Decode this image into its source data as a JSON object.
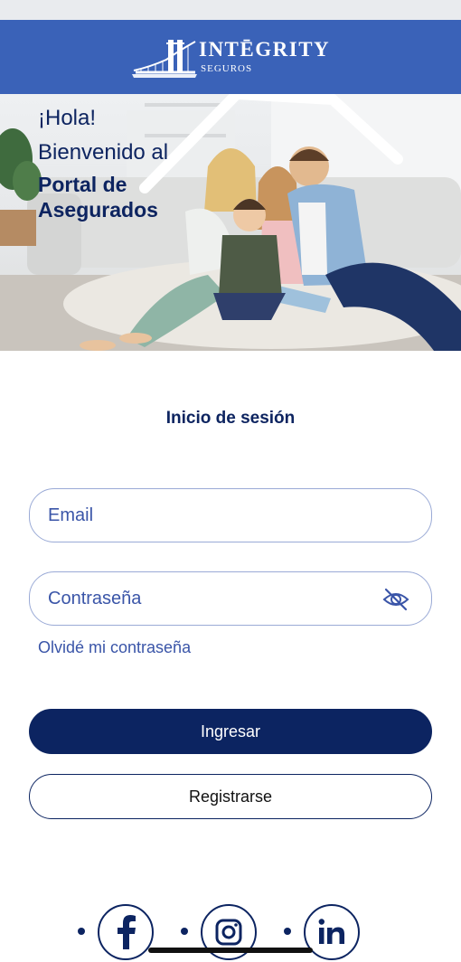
{
  "brand": {
    "name": "INTĒGRITY",
    "subtitle": "SEGUROS"
  },
  "hero": {
    "greeting": "¡Hola!",
    "welcome": "Bienvenido al",
    "portal_line1": "Portal de",
    "portal_line2": "Asegurados"
  },
  "login": {
    "title": "Inicio de sesión",
    "email_placeholder": "Email",
    "password_placeholder": "Contraseña",
    "forgot_password": "Olvidé mi contraseña",
    "submit_label": "Ingresar",
    "register_label": "Registrarse"
  },
  "social": {
    "items": [
      {
        "name": "facebook-icon"
      },
      {
        "name": "instagram-icon"
      },
      {
        "name": "linkedin-icon"
      }
    ]
  },
  "colors": {
    "header_bg": "#3a62b8",
    "brand_navy": "#0c2461",
    "link_blue": "#3a55a8",
    "field_border": "#9aaad6"
  }
}
